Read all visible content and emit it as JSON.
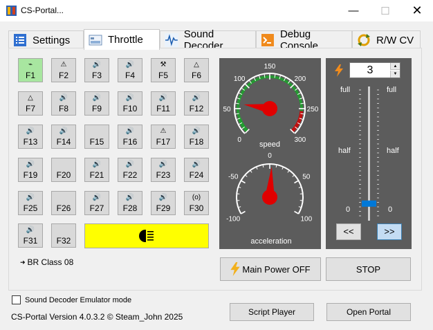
{
  "window": {
    "title": "CS-Portal...",
    "minimize": "—",
    "maximize": "☐",
    "close": "✕"
  },
  "tabs": [
    {
      "label": "Settings",
      "icon": "list-icon"
    },
    {
      "label": "Throttle",
      "icon": "throttle-icon"
    },
    {
      "label": "Sound Decoder",
      "icon": "waveform-icon"
    },
    {
      "label": "Debug Console",
      "icon": "console-icon"
    },
    {
      "label": "R/W CV",
      "icon": "refresh-icon"
    }
  ],
  "functions": [
    {
      "label": "F1",
      "symbol": "⌁",
      "on": true
    },
    {
      "label": "F2",
      "symbol": "⚠"
    },
    {
      "label": "F3",
      "symbol": "🔊"
    },
    {
      "label": "F4",
      "symbol": "🔊"
    },
    {
      "label": "F5",
      "symbol": "⚒"
    },
    {
      "label": "F6",
      "symbol": "△"
    },
    {
      "label": "F7",
      "symbol": "△"
    },
    {
      "label": "F8",
      "symbol": "🔊"
    },
    {
      "label": "F9",
      "symbol": "🔊"
    },
    {
      "label": "F10",
      "symbol": "🔊"
    },
    {
      "label": "F11",
      "symbol": "🔊"
    },
    {
      "label": "F12",
      "symbol": "🔊"
    },
    {
      "label": "F13",
      "symbol": "🔊"
    },
    {
      "label": "F14",
      "symbol": "🔊"
    },
    {
      "label": "F15",
      "symbol": ""
    },
    {
      "label": "F16",
      "symbol": "🔊"
    },
    {
      "label": "F17",
      "symbol": "⚠"
    },
    {
      "label": "F18",
      "symbol": "🔊"
    },
    {
      "label": "F19",
      "symbol": "🔊"
    },
    {
      "label": "F20",
      "symbol": ""
    },
    {
      "label": "F21",
      "symbol": "🔊"
    },
    {
      "label": "F22",
      "symbol": "🔊"
    },
    {
      "label": "F23",
      "symbol": "🔊"
    },
    {
      "label": "F24",
      "symbol": "🔊"
    },
    {
      "label": "F25",
      "symbol": "🔊"
    },
    {
      "label": "F26",
      "symbol": ""
    },
    {
      "label": "F27",
      "symbol": "🔊"
    },
    {
      "label": "F28",
      "symbol": "🔊"
    },
    {
      "label": "F29",
      "symbol": "🔊"
    },
    {
      "label": "F30",
      "symbol": "(o)"
    },
    {
      "label": "F31",
      "symbol": "🔊"
    },
    {
      "label": "F32",
      "symbol": ""
    }
  ],
  "headlight": {
    "icon": "headlight-icon",
    "color": "#ffff00"
  },
  "loco": {
    "icon": "arrow-icon",
    "name": "BR Class 08"
  },
  "speed_gauge": {
    "label": "speed",
    "ticks": [
      "0",
      "50",
      "100",
      "150",
      "200",
      "250",
      "300"
    ],
    "value": 60
  },
  "accel_gauge": {
    "label": "acceleration",
    "ticks": [
      "-100",
      "-50",
      "0",
      "50",
      "100"
    ],
    "value": 3
  },
  "slider": {
    "step_value": "3",
    "left_labels": {
      "full": "full",
      "half": "half",
      "zero": "0"
    },
    "right_labels": {
      "full": "full",
      "half": "half",
      "zero": "0"
    },
    "level_fraction": 0.1,
    "back_button": "<<",
    "forward_button": ">>"
  },
  "buttons": {
    "main_power": "Main Power OFF",
    "stop": "STOP",
    "script_player": "Script Player",
    "open_portal": "Open Portal"
  },
  "emulator_checkbox": {
    "label": "Sound Decoder Emulator mode",
    "checked": false
  },
  "version": "CS-Portal Version 4.0.3.2  © Steam_John 2025",
  "colors": {
    "gauge_bg": "#5c5c5c",
    "needle": "#e00000",
    "arc_green": "#1f9e2e",
    "arc_red": "#c01010",
    "slider_thumb": "#0078d7",
    "active_function": "#a8e6a0"
  }
}
